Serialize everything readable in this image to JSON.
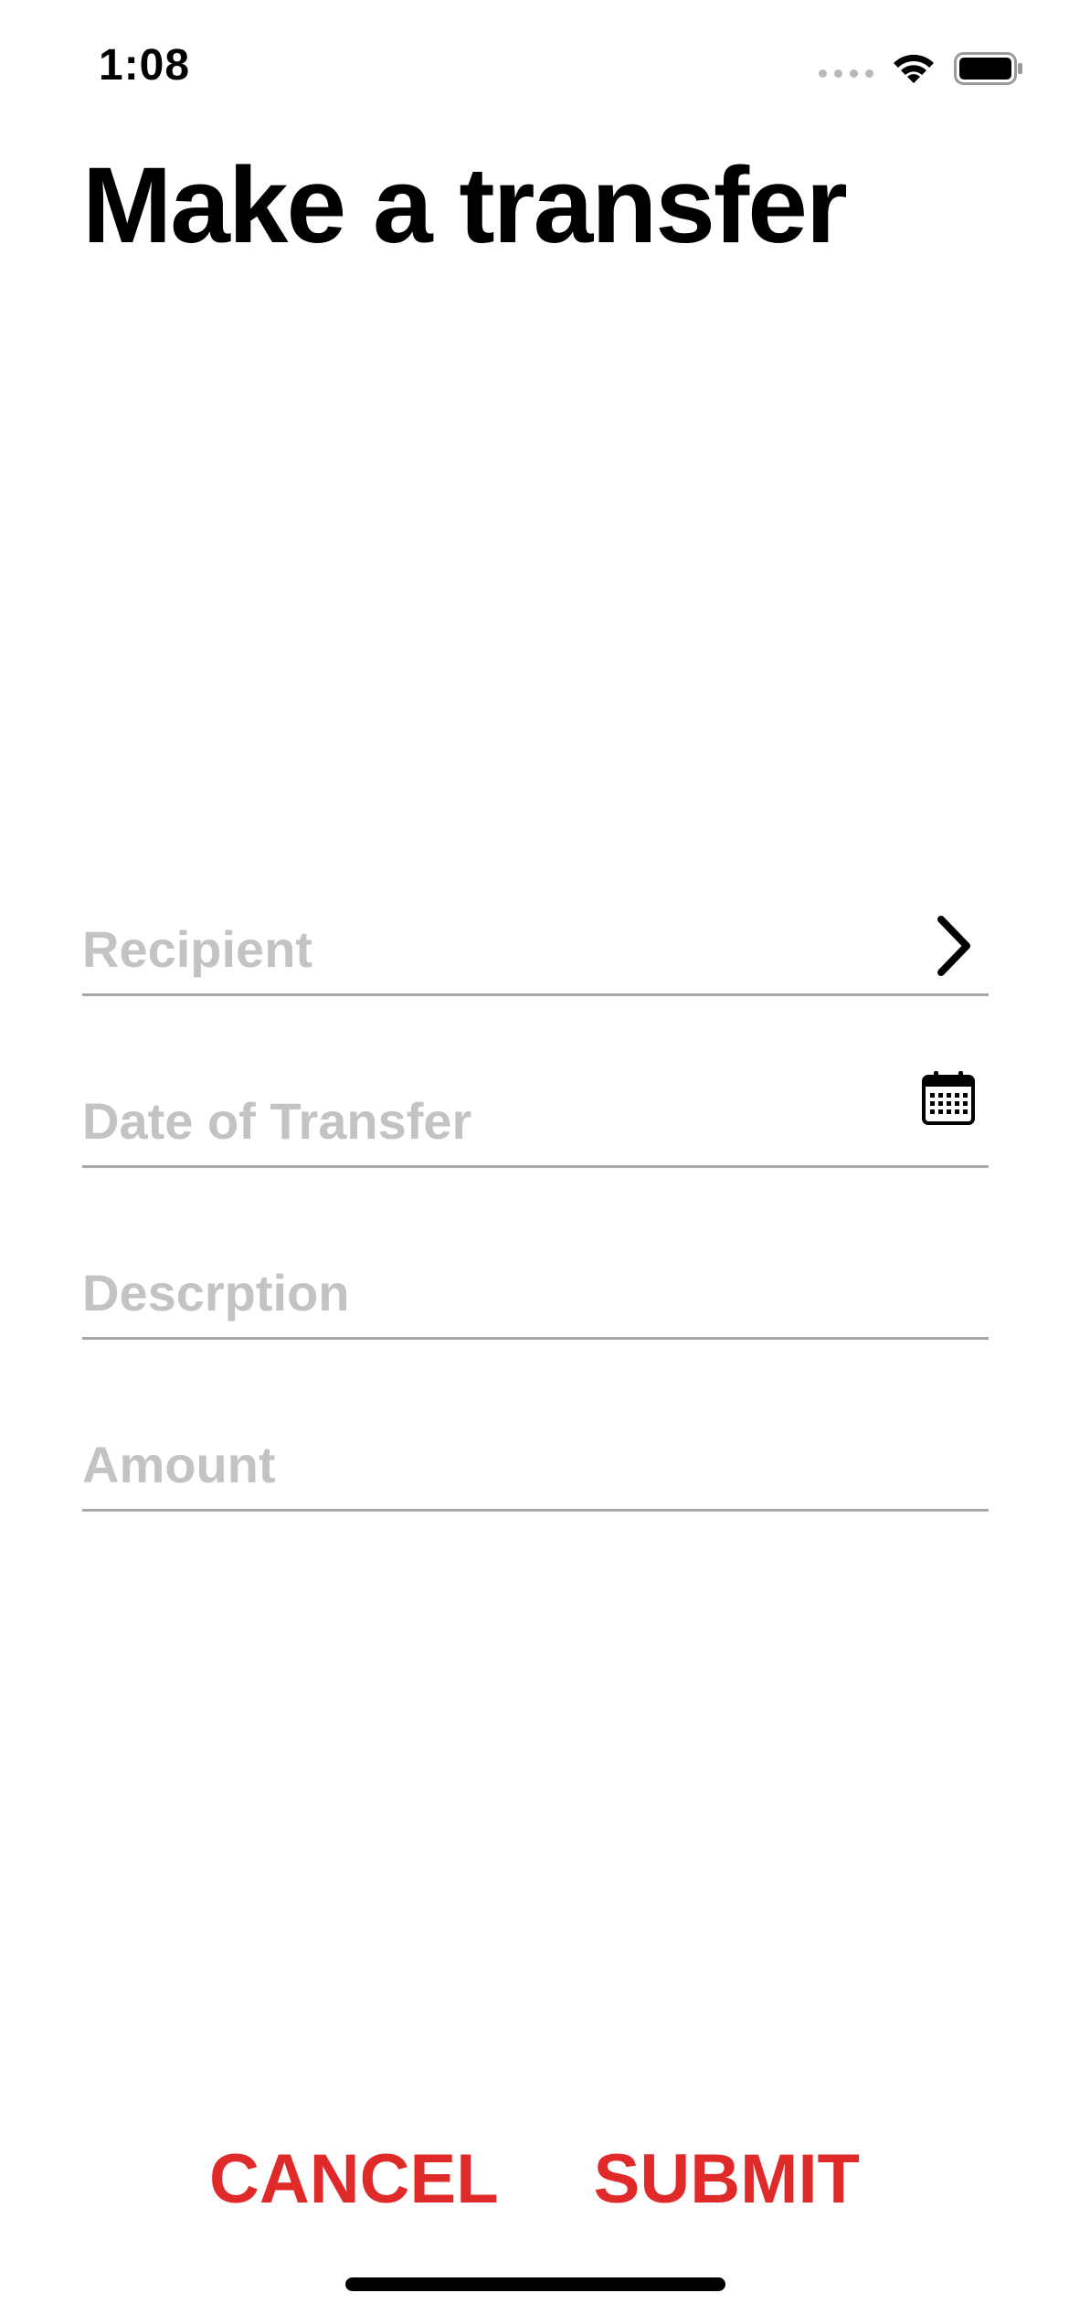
{
  "status_bar": {
    "time": "1:08",
    "signal_icon": "signal-dots-icon",
    "wifi_icon": "wifi-icon",
    "battery_icon": "battery-icon",
    "battery_level": 1.0
  },
  "page": {
    "title": "Make a transfer"
  },
  "form": {
    "recipient": {
      "placeholder": "Recipient",
      "value": "",
      "icon": "chevron-right-icon"
    },
    "date": {
      "placeholder": "Date of Transfer",
      "value": "",
      "icon": "calendar-icon"
    },
    "description": {
      "placeholder": "Descrption",
      "value": ""
    },
    "amount": {
      "placeholder": "Amount",
      "value": ""
    }
  },
  "actions": {
    "cancel_label": "CANCEL",
    "submit_label": "SUBMIT",
    "accent_color": "#e02a2a"
  }
}
